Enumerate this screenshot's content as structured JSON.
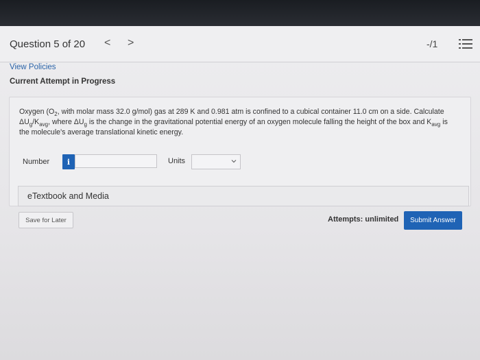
{
  "header": {
    "question_title": "Question 5 of 20",
    "prev_glyph": "<",
    "next_glyph": ">",
    "score": "-/1"
  },
  "links": {
    "view_policies": "View Policies",
    "current_attempt": "Current Attempt in Progress"
  },
  "question": {
    "line1_pre": "Oxygen (O",
    "line1_sub": "2",
    "line1_post": ", with molar mass 32.0 g/mol) gas at 289 K and 0.981 atm is confined to a cubical container 11.0 cm on a side. Calculate",
    "line2_a": "ΔU",
    "line2_a_sub": "g",
    "line2_slash": "/K",
    "line2_slash_sub": "avg",
    "line2_mid": ", where ΔU",
    "line2_mid_sub": "g",
    "line2_post": " is the change in the gravitational potential energy of an oxygen molecule falling the height of the box and K",
    "line2_post_sub": "avg",
    "line2_end": " is",
    "line3": "the molecule's average translational kinetic energy."
  },
  "answer": {
    "number_label": "Number",
    "info_glyph": "i",
    "number_value": "",
    "units_label": "Units",
    "units_value": ""
  },
  "resources": {
    "etextbook_label": "eTextbook and Media"
  },
  "footer": {
    "save_label": "Save for Later",
    "attempts_label": "Attempts: unlimited",
    "submit_label": "Submit Answer"
  },
  "colors": {
    "accent": "#1f63b5",
    "link": "#2a63a8"
  }
}
